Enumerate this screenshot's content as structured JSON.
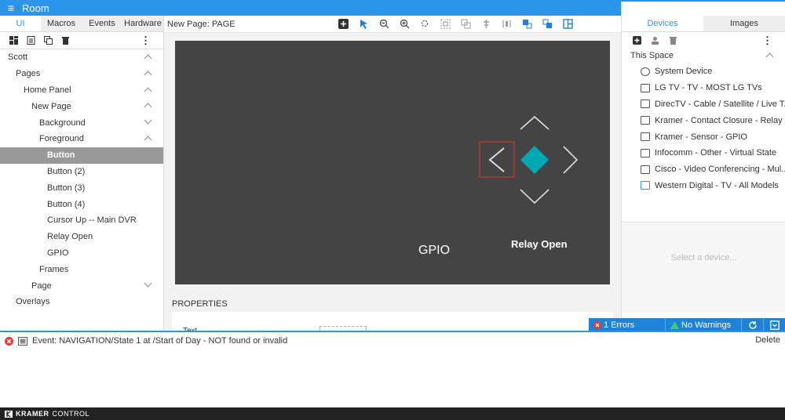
{
  "app": {
    "title": "Room",
    "menu_icon": "hamburger-icon"
  },
  "left_panel": {
    "tabs": [
      {
        "label": "UI"
      },
      {
        "label": "Macros"
      },
      {
        "label": "Events"
      },
      {
        "label": "Hardware"
      }
    ],
    "tree": [
      {
        "label": "Scott"
      },
      {
        "label": "Pages"
      },
      {
        "label": "Home Panel"
      },
      {
        "label": "New Page"
      },
      {
        "label": "Background"
      },
      {
        "label": "Foreground"
      },
      {
        "label": "Button"
      },
      {
        "label": "Button (2)"
      },
      {
        "label": "Button (3)"
      },
      {
        "label": "Button (4)"
      },
      {
        "label": "Cursor Up -- Main DVR"
      },
      {
        "label": "Relay Open"
      },
      {
        "label": "GPIO"
      },
      {
        "label": "Frames"
      },
      {
        "label": "Page"
      },
      {
        "label": "Overlays"
      }
    ]
  },
  "center": {
    "page_label": "New Page: PAGE",
    "canvas": {
      "gpio_label": "GPIO",
      "relay_label": "Relay Open"
    },
    "properties_title": "PROPERTIES",
    "properties_text_label": "Text"
  },
  "right_panel": {
    "tabs": [
      {
        "label": "Devices"
      },
      {
        "label": "Images"
      }
    ],
    "space_title": "This Space",
    "devices": [
      {
        "label": "System Device",
        "icon": "gear-icon"
      },
      {
        "label": "LG TV - TV - MOST LG TVs",
        "icon": "tv-icon"
      },
      {
        "label": "DirecTV - Cable / Satellite / Live T...",
        "icon": "dvr-icon"
      },
      {
        "label": "Kramer - Contact Closure - Relay",
        "icon": "relay-icon"
      },
      {
        "label": "Kramer - Sensor - GPIO",
        "icon": "sensor-icon"
      },
      {
        "label": "Infocomm - Other - Virtual State",
        "icon": "virtual-icon"
      },
      {
        "label": "Cisco - Video Conferencing - Mul...",
        "icon": "video-conf-icon"
      },
      {
        "label": "Western Digital - TV - All Models",
        "icon": "tv-icon"
      }
    ],
    "placeholder": "Select a device..."
  },
  "status": {
    "errors": "1 Errors",
    "warnings": "No Warnings"
  },
  "log": {
    "entries": [
      {
        "text": "Event: NAVIGATION/State 1 at /Start of Day - NOT found or invalid"
      }
    ],
    "delete_label": "Delete"
  },
  "footer": {
    "brand": "KRAMER",
    "product": "CONTROL"
  },
  "colors": {
    "accent": "#2b95e9",
    "canvas": "#444444",
    "diamond": "#00a8b5",
    "error": "#e53935",
    "ok": "#3ccf6b"
  }
}
